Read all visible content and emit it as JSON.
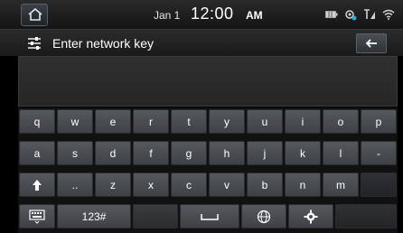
{
  "status_bar": {
    "date": "Jan 1",
    "time": "12:00",
    "ampm": "AM",
    "icons": [
      "battery-icon",
      "gps-icon",
      "signal-icon",
      "wifi-icon"
    ]
  },
  "title_bar": {
    "title": "Enter network key",
    "menu_icon": "settings-sliders-icon",
    "back_icon": "back-arrow-icon"
  },
  "input": {
    "value": "",
    "placeholder": ""
  },
  "keyboard": {
    "row1": [
      "q",
      "w",
      "e",
      "r",
      "t",
      "y",
      "u",
      "i",
      "o",
      "p"
    ],
    "row2": [
      "a",
      "s",
      "d",
      "f",
      "g",
      "h",
      "j",
      "k",
      "l",
      "-"
    ],
    "row3": [
      "shift",
      "..",
      "z",
      "x",
      "c",
      "v",
      "b",
      "n",
      "m",
      ""
    ],
    "row4": {
      "keyboard_key": "keyboard-icon",
      "numeric_label": "123#",
      "space_icon": "space-icon",
      "globe_icon": "globe-icon",
      "settings_icon": "gear-icon"
    }
  }
}
